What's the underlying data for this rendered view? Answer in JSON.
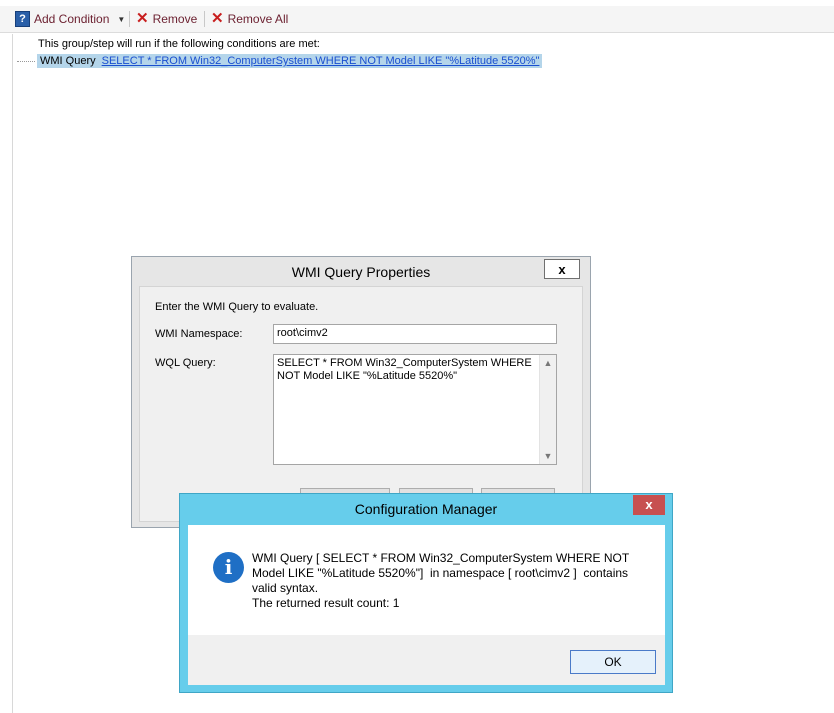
{
  "toolbar": {
    "add_condition": "Add Condition",
    "remove": "Remove",
    "remove_all": "Remove All"
  },
  "conditions": {
    "header": "This group/step will run if the following conditions are met:",
    "item_type": "WMI Query",
    "item_query": "SELECT * FROM Win32_ComputerSystem WHERE NOT Model LIKE \"%Latitude 5520%\""
  },
  "wmi_dialog": {
    "title": "WMI Query Properties",
    "close": "x",
    "intro": "Enter the WMI Query to evaluate.",
    "namespace_label": "WMI Namespace:",
    "namespace_value": "root\\cimv2",
    "wql_label": "WQL Query:",
    "wql_value": "SELECT * FROM Win32_ComputerSystem WHERE NOT Model LIKE \"%Latitude 5520%\""
  },
  "cm_dialog": {
    "title": "Configuration Manager",
    "close": "x",
    "icon": "i",
    "message_lines": [
      "WMI Query [ SELECT * FROM Win32_ComputerSystem WHERE NOT",
      "Model LIKE \"%Latitude 5520%\"]  in namespace [ root\\cimv2 ]  contains",
      "valid syntax.",
      "The returned result count: 1"
    ],
    "ok": "OK"
  },
  "colors": {
    "cm_title_bar": "#66cdeb",
    "close_red": "#c75050",
    "selection": "#b4d5ea",
    "link_blue": "#1a4fd0",
    "info_icon": "#1f6fc5"
  }
}
